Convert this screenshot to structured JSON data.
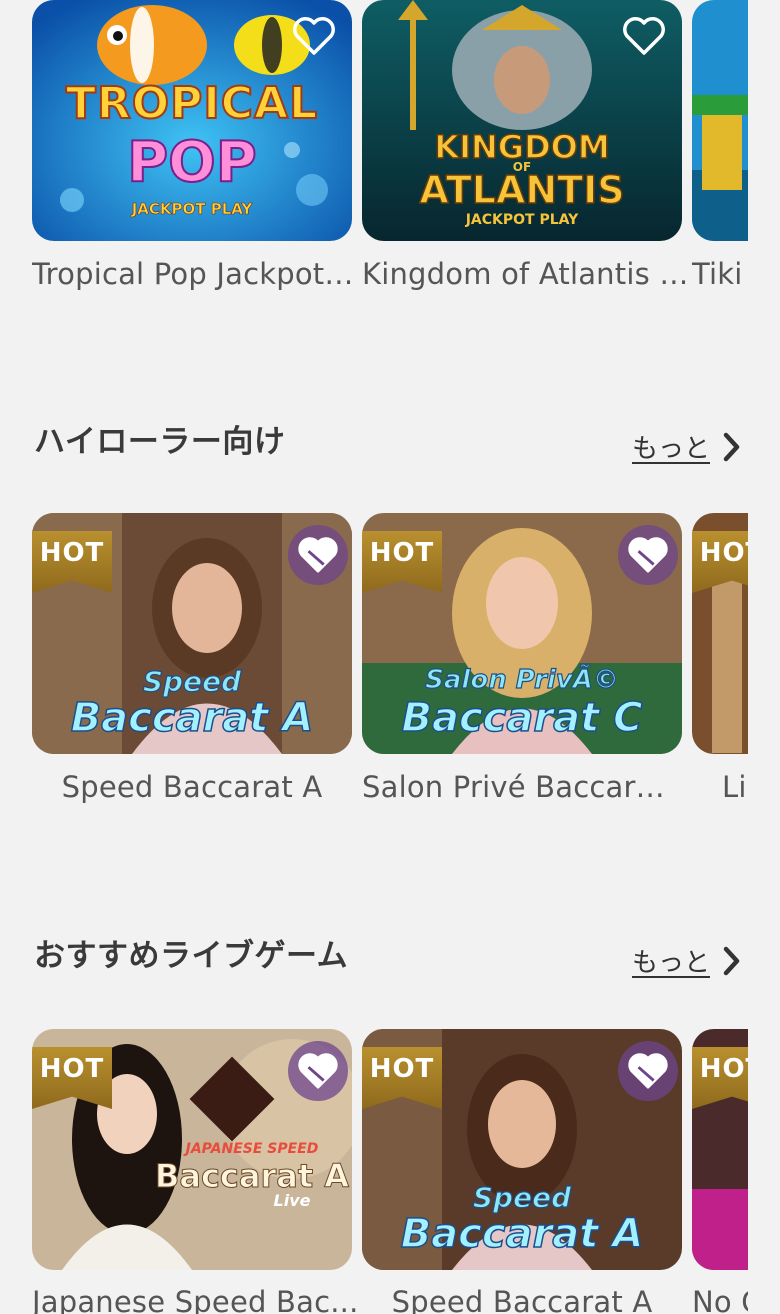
{
  "row1": {
    "cards": [
      {
        "title": "Tropical Pop Jackpot ...",
        "logo_line1": "TROPICAL",
        "logo_line2": "POP",
        "logo_line3": "JACKPOT PLAY"
      },
      {
        "title": "Kingdom of Atlantis J...",
        "logo_line1": "KINGDOM",
        "logo_line2": "OF",
        "logo_line3": "ATLANTIS",
        "logo_line4": "JACKPOT PLAY"
      },
      {
        "title": "Tiki"
      }
    ]
  },
  "sections": [
    {
      "title": "ハイローラー向け",
      "more_label": "もっと",
      "cards": [
        {
          "title": "Speed Baccarat A",
          "badge": "HOT",
          "logo_line1": "Speed",
          "logo_line2": "Baccarat A"
        },
        {
          "title": "Salon Privé Baccarat C",
          "badge": "HOT",
          "logo_line1": "Salon PrivÃ©",
          "logo_line2": "Baccarat C"
        },
        {
          "title": "Lig",
          "badge": "HOT"
        }
      ]
    },
    {
      "title": "おすすめライブゲーム",
      "more_label": "もっと",
      "cards": [
        {
          "title": "Japanese Speed Bac...",
          "badge": "HOT",
          "logo_line1": "JAPANESE SPEED",
          "logo_line2": "Baccarat A",
          "logo_line3": "Live"
        },
        {
          "title": "Speed Baccarat A",
          "badge": "HOT",
          "logo_line1": "Speed",
          "logo_line2": "Baccarat A"
        },
        {
          "title": "No C",
          "badge": "HOT"
        }
      ]
    }
  ],
  "icons": {
    "favorite": "heart-outline-icon",
    "favorite_bubble": "heart-icon",
    "more": "chevron-right-icon"
  },
  "colors": {
    "background": "#f2f2f2",
    "hot_badge": "#a67f27",
    "fav_bubble": "#6e468c"
  }
}
